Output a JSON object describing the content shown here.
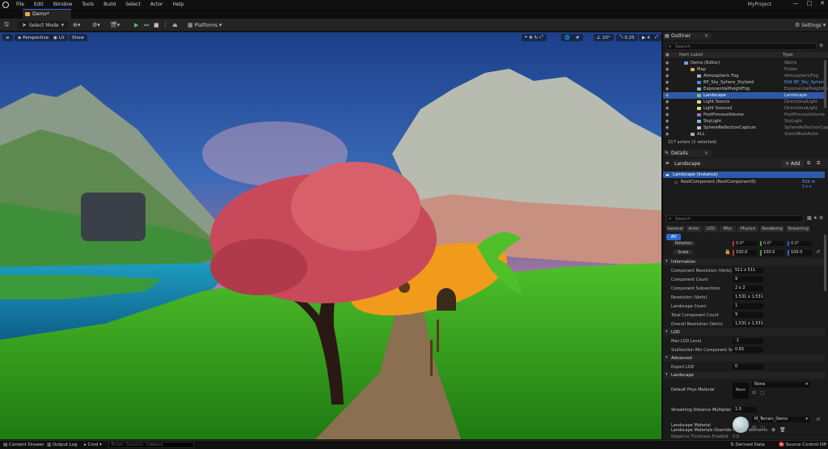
{
  "menubar": {
    "items": [
      "File",
      "Edit",
      "Window",
      "Tools",
      "Build",
      "Select",
      "Actor",
      "Help"
    ],
    "project_name": "MyProject"
  },
  "tabs": [
    {
      "label": "Demo*"
    }
  ],
  "toolbar": {
    "mode_label": "Select Mode",
    "platforms_label": "Platforms",
    "settings_label": "Settings"
  },
  "viewport": {
    "perspective_label": "Perspective",
    "lit_label": "Lit",
    "show_label": "Show",
    "snap_angle": "10°",
    "snap_scale": "0.25",
    "camera_speed": "4"
  },
  "outliner": {
    "tab_label": "Outliner",
    "search_placeholder": "Search",
    "col_item_label": "Item Label",
    "col_type": "Type",
    "rows": [
      {
        "name": "Demo (Editor)",
        "type": "World",
        "indent": 1,
        "selected": false,
        "icon": "world-icon"
      },
      {
        "name": "Map",
        "type": "Folder",
        "indent": 2,
        "selected": false,
        "icon": "folder-icon"
      },
      {
        "name": "Atmospheric Fog",
        "type": "AtmosphericFog",
        "indent": 3,
        "selected": false,
        "icon": "fog-icon"
      },
      {
        "name": "BP_Sky_Sphere_Stylized",
        "type": "Edit BP_Sky_Sphere",
        "indent": 3,
        "selected": false,
        "icon": "blueprint-icon"
      },
      {
        "name": "ExponentialHeightFog",
        "type": "ExponentialHeightFo",
        "indent": 3,
        "selected": false,
        "icon": "fog-icon"
      },
      {
        "name": "Landscape",
        "type": "Landscape",
        "indent": 3,
        "selected": true,
        "icon": "landscape-icon"
      },
      {
        "name": "Light Source",
        "type": "DirectionalLight",
        "indent": 3,
        "selected": false,
        "icon": "light-icon"
      },
      {
        "name": "Light Source2",
        "type": "DirectionalLight",
        "indent": 3,
        "selected": false,
        "icon": "light-icon"
      },
      {
        "name": "PostProcessVolume",
        "type": "PostProcessVolume",
        "indent": 3,
        "selected": false,
        "icon": "volume-icon"
      },
      {
        "name": "SkyLight",
        "type": "SkyLight",
        "indent": 3,
        "selected": false,
        "icon": "skylight-icon"
      },
      {
        "name": "SphereReflectionCapture",
        "type": "SphereReflectionCap",
        "indent": 3,
        "selected": false,
        "icon": "sphere-icon"
      },
      {
        "name": "ALL",
        "type": "StaticMeshActor",
        "indent": 2,
        "selected": false,
        "icon": "mesh-icon"
      }
    ],
    "actor_count": "217 actors (1 selected)"
  },
  "details": {
    "tab_label": "Details",
    "actor_name": "Landscape",
    "add_label": "+ Add",
    "instance_label": "Landscape (Instance)",
    "root_component_label": "RootComponent (RootComponent0)",
    "edit_cpp_label": "Edit in C++",
    "search_placeholder": "Search",
    "categories": [
      "General",
      "Actor",
      "LOD",
      "Misc",
      "Physics",
      "Rendering",
      "Streaming"
    ],
    "all_label": "All",
    "rotation_label": "Rotation",
    "scale_label": "Scale",
    "rotation_values": [
      "0.0°",
      "0.0°",
      "0.0°"
    ],
    "scale_values": [
      "100.0",
      "100.0",
      "100.0"
    ],
    "sections": {
      "information": "Information",
      "lod": "LOD",
      "advanced": "Advanced",
      "landscape": "Landscape"
    },
    "info_rows": [
      {
        "label": "Component Resolution (Verts)",
        "value": "511 x 511"
      },
      {
        "label": "Component Count",
        "value": "9"
      },
      {
        "label": "Component Subsections",
        "value": "2 x 2"
      },
      {
        "label": "Resolution (Verts)",
        "value": "1,531 x 1,531"
      },
      {
        "label": "Landscape Count",
        "value": "1"
      },
      {
        "label": "Total Component Count",
        "value": "9"
      },
      {
        "label": "Overall Resolution (Verts)",
        "value": "1,531 x 1,531"
      }
    ],
    "lod_rows": [
      {
        "label": "Max LOD Level",
        "value": "-1"
      },
      {
        "label": "SubSection Min Component Scree...",
        "value": "0.65"
      }
    ],
    "advanced_rows": [
      {
        "label": "Export LOD",
        "value": "0"
      }
    ],
    "landscape_rows": {
      "phys_material_label": "Default Phys Material",
      "phys_material_value": "None",
      "phys_material_thumb": "None",
      "streaming_label": "Streaming Distance Multiplier",
      "streaming_value": "1.0",
      "material_label": "Landscape Material",
      "material_value": "M_Terrain_Demo",
      "override_label": "Landscape Materials Override",
      "override_value": "0 Array elements",
      "next_label": "Negative Thickness Enabled",
      "next_value": "0.0"
    }
  },
  "statusbar": {
    "content_drawer": "Content Drawer",
    "output_log": "Output Log",
    "cmd": "Cmd",
    "console_placeholder": "Enter Console Command",
    "derived_data": "Derived Data",
    "source_control": "Source Control Off"
  },
  "colors": {
    "accent": "#2f6ad3",
    "selection": "#2c5aa8",
    "play": "#5ac85a"
  }
}
